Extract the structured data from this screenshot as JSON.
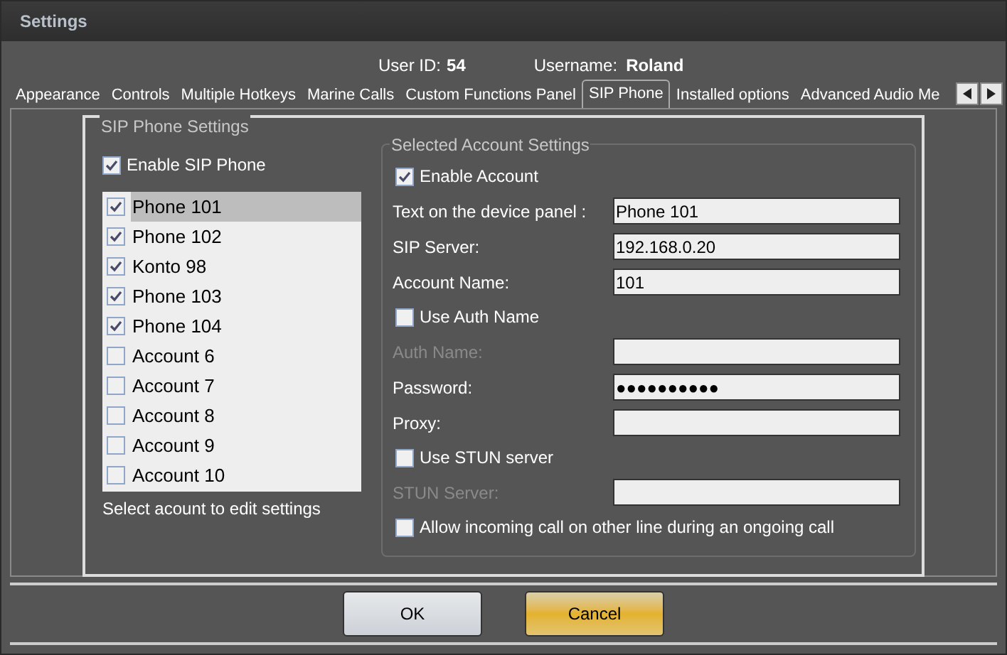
{
  "window": {
    "title": "Settings"
  },
  "user": {
    "id_label": "User ID:",
    "id": "54",
    "name_label": "Username:",
    "name": "Roland"
  },
  "tabs": [
    {
      "label": "Appearance",
      "selected": false
    },
    {
      "label": "Controls",
      "selected": false
    },
    {
      "label": "Multiple Hotkeys",
      "selected": false
    },
    {
      "label": "Marine Calls",
      "selected": false
    },
    {
      "label": "Custom Functions Panel",
      "selected": false
    },
    {
      "label": "SIP Phone",
      "selected": true
    },
    {
      "label": "Installed options",
      "selected": false
    },
    {
      "label": "Advanced Audio Me",
      "selected": false
    }
  ],
  "sip_group": {
    "title": "SIP Phone Settings",
    "enable": {
      "label": "Enable SIP Phone",
      "checked": true
    },
    "accounts": [
      {
        "label": "Phone 101",
        "checked": true,
        "selected": true
      },
      {
        "label": "Phone 102",
        "checked": true,
        "selected": false
      },
      {
        "label": "Konto 98",
        "checked": true,
        "selected": false
      },
      {
        "label": "Phone 103",
        "checked": true,
        "selected": false
      },
      {
        "label": "Phone 104",
        "checked": true,
        "selected": false
      },
      {
        "label": "Account 6",
        "checked": false,
        "selected": false
      },
      {
        "label": "Account 7",
        "checked": false,
        "selected": false
      },
      {
        "label": "Account 8",
        "checked": false,
        "selected": false
      },
      {
        "label": "Account 9",
        "checked": false,
        "selected": false
      },
      {
        "label": "Account 10",
        "checked": false,
        "selected": false
      }
    ],
    "hint": "Select acount to edit settings"
  },
  "account_group": {
    "title": "Selected Account Settings",
    "rows": [
      {
        "kind": "checkbox",
        "label": "Enable Account",
        "checked": true
      },
      {
        "kind": "field",
        "label": "Text on the device panel :",
        "value": "Phone 101",
        "disabled": false
      },
      {
        "kind": "field",
        "label": "SIP Server:",
        "value": "192.168.0.20",
        "disabled": false
      },
      {
        "kind": "field",
        "label": "Account Name:",
        "value": "101",
        "disabled": false
      },
      {
        "kind": "checkbox",
        "label": "Use Auth Name",
        "checked": false
      },
      {
        "kind": "field",
        "label": "Auth Name:",
        "disabled": true
      },
      {
        "kind": "field",
        "label": "Password:",
        "value": "●●●●●●●●●●",
        "disabled": false
      },
      {
        "kind": "field",
        "label": "Proxy:",
        "disabled": false
      },
      {
        "kind": "checkbox",
        "label": "Use STUN server",
        "checked": false
      },
      {
        "kind": "field",
        "label": "STUN Server:",
        "disabled": true
      },
      {
        "kind": "checkbox",
        "label": "Allow incoming call on other line during an ongoing call",
        "checked": false
      }
    ]
  },
  "buttons": [
    {
      "label": "OK",
      "kind": "default"
    },
    {
      "label": "Cancel",
      "kind": "accent"
    }
  ]
}
